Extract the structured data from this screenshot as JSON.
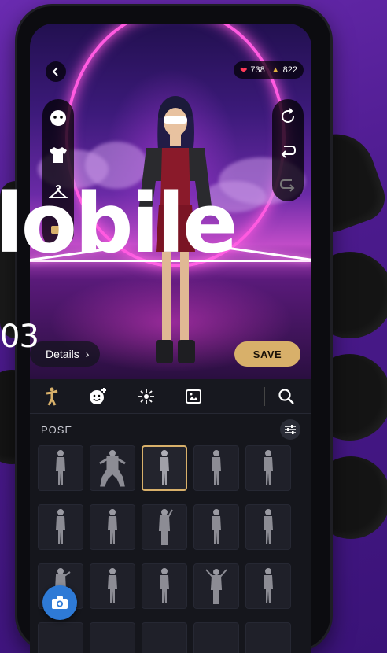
{
  "overlay": {
    "title": "lobile",
    "number": "03"
  },
  "currency": {
    "hearts": "738",
    "coins": "822"
  },
  "scene": {
    "details_label": "Details",
    "save_label": "SAVE"
  },
  "section": {
    "title": "POSE"
  },
  "tabs": [
    "pose-icon",
    "emote-icon",
    "effects-icon",
    "background-icon",
    "search-icon"
  ],
  "colors": {
    "accent_gold": "#d8b06a",
    "fab_blue": "#2e7ad6",
    "portal_pink": "#ff5ae0"
  }
}
